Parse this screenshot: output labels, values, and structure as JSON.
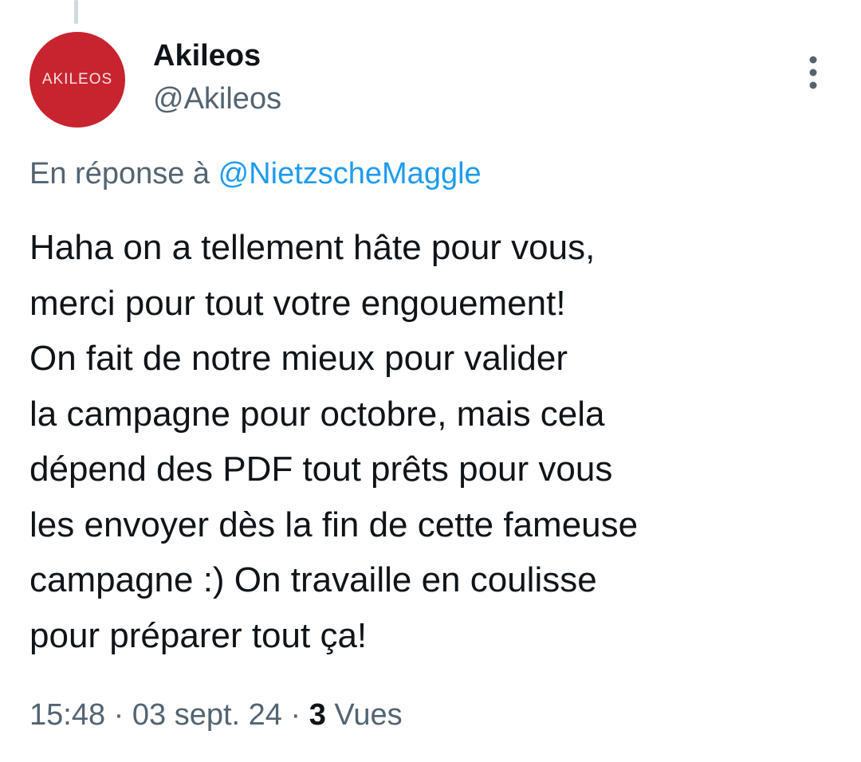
{
  "author": {
    "display_name": "Akileos",
    "handle": "@Akileos",
    "avatar_text": "AKILEOS"
  },
  "reply": {
    "prefix": "En réponse à ",
    "mention": "@NietzscheMaggle"
  },
  "tweet": {
    "lines": [
      "Haha on a tellement hâte pour vous,",
      "merci pour tout votre engouement!",
      "On fait de notre mieux pour valider",
      "la campagne pour octobre, mais cela",
      "dépend des PDF tout prêts pour vous",
      "les envoyer dès la fin de cette fameuse",
      "campagne :) On travaille en coulisse",
      "pour préparer tout ça!"
    ]
  },
  "meta": {
    "time": "15:48",
    "separator": " · ",
    "date": "03 sept. 24",
    "views_count": "3",
    "views_label": "Vues"
  },
  "icons": {
    "more": "more-vertical-icon"
  },
  "colors": {
    "avatar_bg": "#c8242f",
    "mention": "#1d9bf0",
    "secondary_text": "#536471",
    "primary_text": "#0f1419"
  }
}
